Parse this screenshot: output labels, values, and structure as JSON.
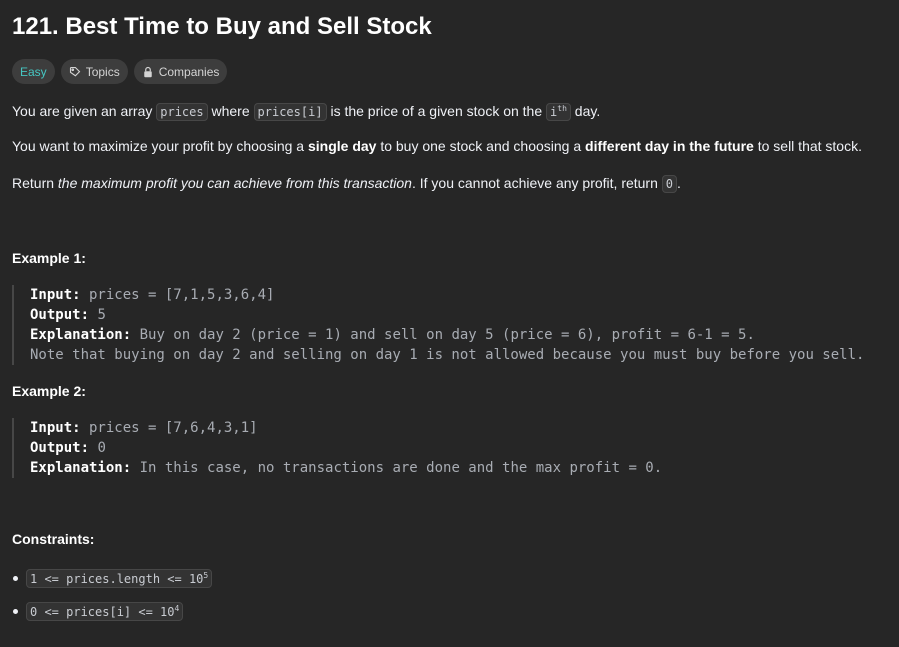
{
  "problem": {
    "title": "121. Best Time to Buy and Sell Stock",
    "tags": {
      "difficulty": "Easy",
      "topics": "Topics",
      "companies": "Companies"
    },
    "p1": {
      "t1": "You are given an array ",
      "c1": "prices",
      "t2": " where ",
      "c2": "prices[i]",
      "t3": " is the price of a given stock on the ",
      "c3_base": "i",
      "c3_sup": "th",
      "t4": " day."
    },
    "p2": {
      "t1": "You want to maximize your profit by choosing a ",
      "b1": "single day",
      "t2": " to buy one stock and choosing a ",
      "b2": "different day in the future",
      "t3": " to sell that stock."
    },
    "p3": {
      "t1": "Return ",
      "i1": "the maximum profit you can achieve from this transaction",
      "t2": ". If you cannot achieve any profit, return ",
      "c1": "0",
      "t3": "."
    }
  },
  "examples": [
    {
      "title": "Example 1:",
      "input_label": "Input:",
      "input_value": " prices = [7,1,5,3,6,4]",
      "output_label": "Output:",
      "output_value": " 5",
      "explanation_label": "Explanation:",
      "explanation_value": " Buy on day 2 (price = 1) and sell on day 5 (price = 6), profit = 6-1 = 5.",
      "note": "Note that buying on day 2 and selling on day 1 is not allowed because you must buy before you sell."
    },
    {
      "title": "Example 2:",
      "input_label": "Input:",
      "input_value": " prices = [7,6,4,3,1]",
      "output_label": "Output:",
      "output_value": " 0",
      "explanation_label": "Explanation:",
      "explanation_value": " In this case, no transactions are done and the max profit = 0."
    }
  ],
  "constraints": {
    "title": "Constraints:",
    "items": [
      {
        "base": "1 <= prices.length <= 10",
        "sup": "5"
      },
      {
        "base": "0 <= prices[i] <= 10",
        "sup": "4"
      }
    ]
  }
}
